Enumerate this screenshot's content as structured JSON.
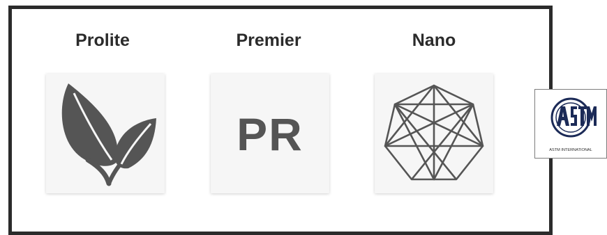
{
  "products": [
    {
      "title": "Prolite",
      "icon": "leaf-icon"
    },
    {
      "title": "Premier",
      "icon": "pr-monogram-icon",
      "monogram": "PR"
    },
    {
      "title": "Nano",
      "icon": "polyhedron-icon"
    }
  ],
  "badge": {
    "icon": "astm-logo",
    "logo_text": "ASTM",
    "caption": "ASTM INTERNATIONAL"
  },
  "colors": {
    "frame": "#2b2b2b",
    "title": "#2b2b2b",
    "icon_gray": "#555555",
    "tile_bg": "#f6f6f6",
    "astm_navy": "#1b2a57"
  }
}
